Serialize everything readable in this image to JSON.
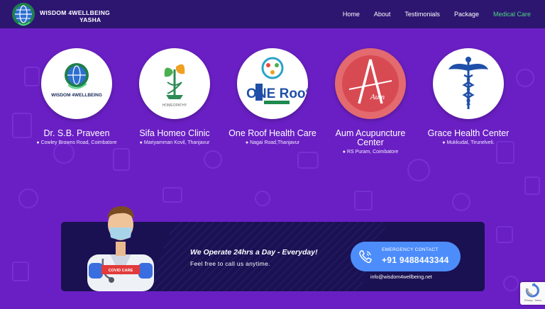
{
  "header": {
    "brand_line1": "WISDOM 4WELLBEING",
    "brand_line2": "YASHA",
    "nav": [
      "Home",
      "About",
      "Testimonials",
      "Package",
      "Medical Care"
    ],
    "active_nav": "Medical Care"
  },
  "clinics": [
    {
      "name": "Dr. S.B. Praveen",
      "address": "Cowley Browns Road, Coimbatore",
      "logo_text": "WISDOM 4WELLBEING"
    },
    {
      "name": "Sifa Homeo Clinic",
      "address": "Mariyamman Kovil, Thanjavur",
      "logo_text": "HOMEOPATHY"
    },
    {
      "name": "One Roof Health Care",
      "address": "Nagai Road,Thanjavur",
      "logo_text": "ONE Roof"
    },
    {
      "name": "Aum Acupuncture Center",
      "address": "RS Puram, Coimbatore",
      "logo_text": "Aum"
    },
    {
      "name": "Grace Health Center",
      "address": "Mukkudal, Tirunelveli.",
      "logo_text": ""
    }
  ],
  "banner": {
    "heading": "We Operate 24hrs a Day - Everyday!",
    "subheading": "Feel free to call us anytime.",
    "badge": "COVID CARE",
    "emergency_label": "EMERGENCY CONTACT",
    "phone": "+91 9488443344",
    "email": "info@wisdom4wellbeing.net"
  },
  "recaptcha": {
    "text": "Privacy - Terms"
  },
  "colors": {
    "page_bg": "#6a1fc4",
    "header_bg": "#2c1670",
    "active_nav": "#4cd680",
    "banner_bg": "#1a1152",
    "emergency_button": "#4d8dfb"
  },
  "icons": [
    "globe-logo-icon",
    "location-pin-icon",
    "phone-icon",
    "caduceus-icon",
    "recaptcha-icon"
  ]
}
